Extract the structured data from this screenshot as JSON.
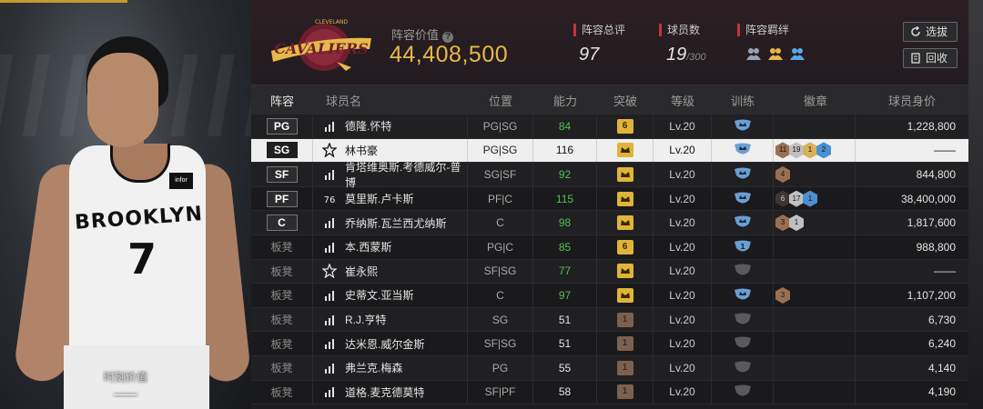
{
  "portrait": {
    "jersey_text": "BROOKLYN",
    "jersey_number": "7",
    "jersey_badge": "infor",
    "value_label": "时刻价值",
    "value": "——"
  },
  "header": {
    "lineup_value_label": "阵容价值",
    "lineup_value": "44,408,500",
    "rating_label": "阵容总评",
    "rating": "97",
    "players_label": "球员数",
    "players_count": "19",
    "players_max": "/300",
    "bond_label": "阵容羁绊",
    "select_label": "选拔",
    "return_label": "回收",
    "logo_top": "CLEVELAND",
    "logo_text": "CAVALIERS"
  },
  "table": {
    "headers": {
      "position": "阵容",
      "name": "球员名",
      "role": "位置",
      "ability": "能力",
      "breakthrough": "突破",
      "level": "等级",
      "training": "训练",
      "badges": "徽章",
      "price": "球员身价"
    },
    "rows": [
      {
        "pos": "PG",
        "name": "德隆.怀特",
        "role": "PG|SG",
        "ability": "84",
        "ability_green": true,
        "brk": "6",
        "brk_color": "gold",
        "level": "Lv.20",
        "train": "crown",
        "badges": [],
        "price": "1,228,800",
        "icon": "bars"
      },
      {
        "pos": "SG",
        "name": "林书豪",
        "role": "PG|SG",
        "ability": "116",
        "ability_green": false,
        "brk": "crown",
        "brk_color": "gold",
        "level": "Lv.20",
        "train": "crown",
        "badges": [
          {
            "t": "11",
            "c": "bronze"
          },
          {
            "t": "19",
            "c": "silver"
          },
          {
            "t": "1",
            "c": "gold"
          },
          {
            "t": "2",
            "c": "blue"
          }
        ],
        "price": "——",
        "icon": "star",
        "selected": true
      },
      {
        "pos": "SF",
        "name": "肯塔维奥斯.考德威尔-普博",
        "role": "SG|SF",
        "ability": "92",
        "ability_green": true,
        "brk": "crown",
        "brk_color": "gold",
        "level": "Lv.20",
        "train": "crown",
        "badges": [
          {
            "t": "4",
            "c": "bronze"
          }
        ],
        "price": "844,800",
        "icon": "bars"
      },
      {
        "pos": "PF",
        "name": "莫里斯.卢卡斯",
        "role": "PF|C",
        "ability": "115",
        "ability_green": true,
        "brk": "crown",
        "brk_color": "gold",
        "level": "Lv.20",
        "train": "crown",
        "badges": [
          {
            "t": "6",
            "c": "dark"
          },
          {
            "t": "17",
            "c": "silver"
          },
          {
            "t": "1",
            "c": "blue"
          }
        ],
        "price": "38,400,000",
        "icon": "76"
      },
      {
        "pos": "C",
        "name": "乔纳斯.瓦兰西尤纳斯",
        "role": "C",
        "ability": "98",
        "ability_green": true,
        "brk": "crown",
        "brk_color": "gold",
        "level": "Lv.20",
        "train": "crown",
        "badges": [
          {
            "t": "3",
            "c": "bronze"
          },
          {
            "t": "1",
            "c": "silver"
          }
        ],
        "price": "1,817,600",
        "icon": "bars"
      },
      {
        "pos": "板凳",
        "name": "本.西蒙斯",
        "role": "PG|C",
        "ability": "85",
        "ability_green": true,
        "brk": "6",
        "brk_color": "gold",
        "level": "Lv.20",
        "train": "1",
        "badges": [],
        "price": "988,800",
        "icon": "bars"
      },
      {
        "pos": "板凳",
        "name": "崔永熙",
        "role": "SF|SG",
        "ability": "77",
        "ability_green": true,
        "brk": "crown",
        "brk_color": "gold",
        "level": "Lv.20",
        "train": "gray",
        "badges": [],
        "price": "——",
        "icon": "star"
      },
      {
        "pos": "板凳",
        "name": "史蒂文.亚当斯",
        "role": "C",
        "ability": "97",
        "ability_green": true,
        "brk": "crown",
        "brk_color": "gold",
        "level": "Lv.20",
        "train": "crown",
        "badges": [
          {
            "t": "3",
            "c": "bronze"
          }
        ],
        "price": "1,107,200",
        "icon": "bars"
      },
      {
        "pos": "板凳",
        "name": "R.J.亨特",
        "role": "SG",
        "ability": "51",
        "ability_green": false,
        "brk": "1",
        "brk_color": "brown",
        "level": "Lv.20",
        "train": "gray",
        "badges": [],
        "price": "6,730",
        "icon": "bars"
      },
      {
        "pos": "板凳",
        "name": "达米恩.威尔金斯",
        "role": "SF|SG",
        "ability": "51",
        "ability_green": false,
        "brk": "1",
        "brk_color": "brown",
        "level": "Lv.20",
        "train": "gray",
        "badges": [],
        "price": "6,240",
        "icon": "bars"
      },
      {
        "pos": "板凳",
        "name": "弗兰克.梅森",
        "role": "PG",
        "ability": "55",
        "ability_green": false,
        "brk": "1",
        "brk_color": "brown",
        "level": "Lv.20",
        "train": "gray",
        "badges": [],
        "price": "4,140",
        "icon": "bars"
      },
      {
        "pos": "板凳",
        "name": "道格.麦克德莫特",
        "role": "SF|PF",
        "ability": "58",
        "ability_green": false,
        "brk": "1",
        "brk_color": "brown",
        "level": "Lv.20",
        "train": "gray",
        "badges": [],
        "price": "4,190",
        "icon": "bars"
      }
    ]
  }
}
